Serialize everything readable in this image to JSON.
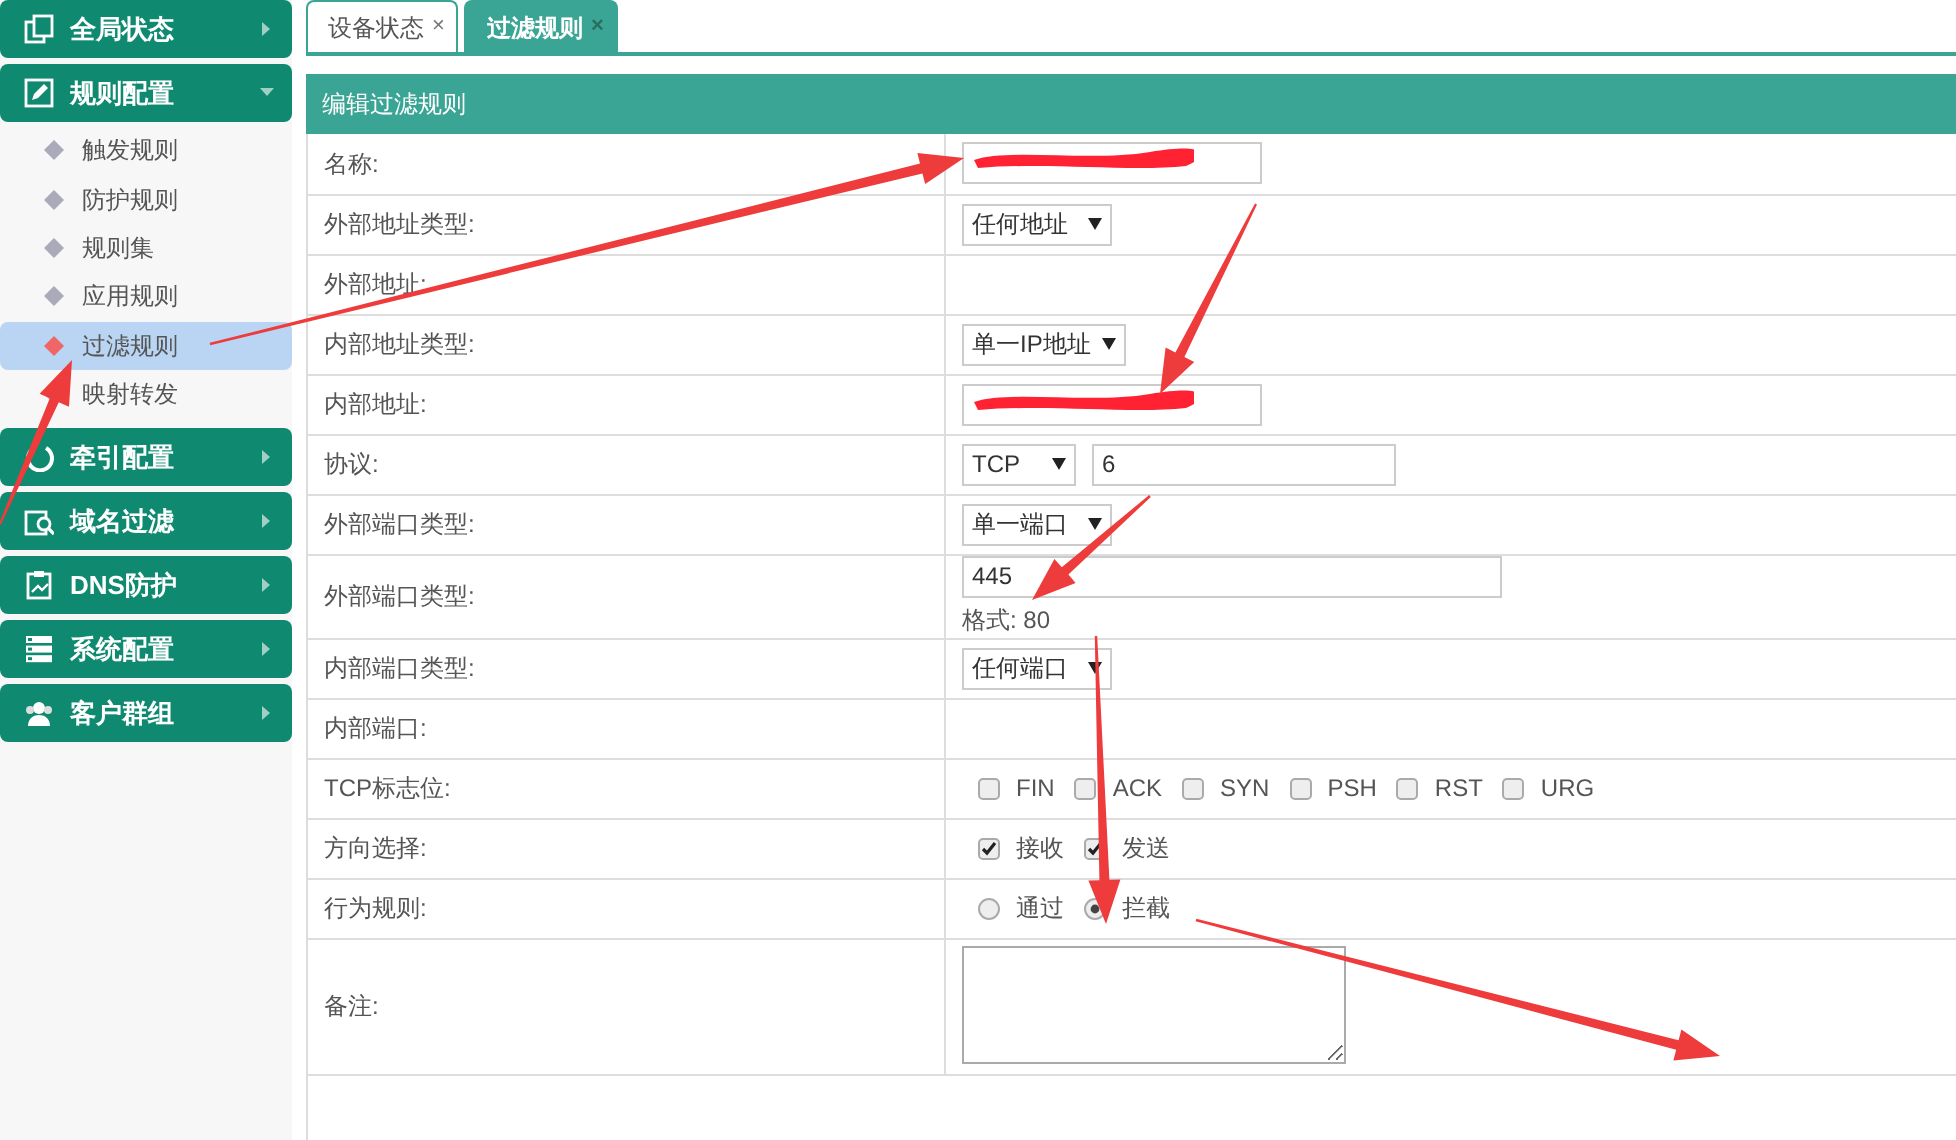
{
  "sidebar": [
    {
      "label": "全局状态",
      "expanded": false
    },
    {
      "label": "规则配置",
      "expanded": true,
      "children": [
        {
          "label": "触发规则",
          "selected": false
        },
        {
          "label": "防护规则",
          "selected": false
        },
        {
          "label": "规则集",
          "selected": false
        },
        {
          "label": "应用规则",
          "selected": false
        },
        {
          "label": "过滤规则",
          "selected": true
        },
        {
          "label": "映射转发",
          "selected": false
        }
      ]
    },
    {
      "label": "牵引配置",
      "expanded": false
    },
    {
      "label": "域名过滤",
      "expanded": false
    },
    {
      "label": "DNS防护",
      "expanded": false
    },
    {
      "label": "系统配置",
      "expanded": false
    },
    {
      "label": "客户群组",
      "expanded": false
    }
  ],
  "tabs": [
    {
      "label": "设备状态",
      "close": "×",
      "selected": false
    },
    {
      "label": "过滤规则",
      "close": "×",
      "selected": true
    }
  ],
  "panel": {
    "title": "编辑过滤规则",
    "rows": [
      {
        "label": "名称:",
        "kind": "text",
        "redacted": true
      },
      {
        "label": "外部地址类型:",
        "kind": "select",
        "value": "任何地址"
      },
      {
        "label": "外部地址:",
        "kind": "empty"
      },
      {
        "label": "内部地址类型:",
        "kind": "select",
        "value": "单一IP地址"
      },
      {
        "label": "内部地址:",
        "kind": "text",
        "redacted": true
      },
      {
        "label": "协议:",
        "kind": "select_text",
        "value": "TCP",
        "text": "6"
      },
      {
        "label": "外部端口类型:",
        "kind": "select",
        "value": "单一端口"
      },
      {
        "label": "外部端口类型:",
        "kind": "text",
        "value": "445",
        "hint": "格式: 80"
      },
      {
        "label": "内部端口类型:",
        "kind": "select",
        "value": "任何端口"
      },
      {
        "label": "内部端口:",
        "kind": "empty"
      },
      {
        "label": "TCP标志位:",
        "kind": "checks",
        "options": [
          {
            "label": "FIN",
            "checked": false
          },
          {
            "label": "ACK",
            "checked": false
          },
          {
            "label": "SYN",
            "checked": false
          },
          {
            "label": "PSH",
            "checked": false
          },
          {
            "label": "RST",
            "checked": false
          },
          {
            "label": "URG",
            "checked": false
          }
        ]
      },
      {
        "label": "方向选择:",
        "kind": "checks",
        "options": [
          {
            "label": "接收",
            "checked": true
          },
          {
            "label": "发送",
            "checked": true
          }
        ]
      },
      {
        "label": "行为规则:",
        "kind": "radios",
        "options": [
          {
            "label": "通过",
            "selected": false
          },
          {
            "label": "拦截",
            "selected": true
          }
        ]
      },
      {
        "label": "备注:",
        "kind": "textarea"
      }
    ]
  },
  "annotation_arrows": [
    {
      "kind": "arrow"
    },
    {
      "kind": "arrow"
    },
    {
      "kind": "arrow"
    },
    {
      "kind": "arrow"
    },
    {
      "kind": "arrow"
    },
    {
      "kind": "arrow"
    }
  ]
}
